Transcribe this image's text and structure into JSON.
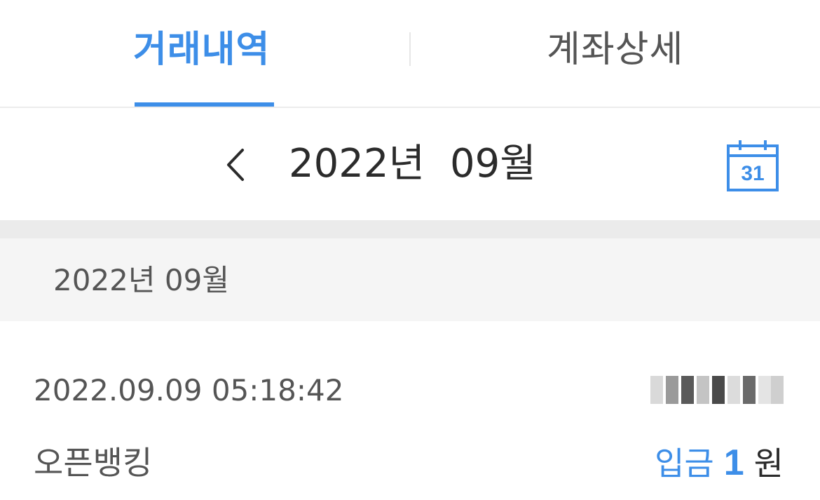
{
  "tabs": [
    {
      "label": "거래내역",
      "active": true
    },
    {
      "label": "계좌상세",
      "active": false
    }
  ],
  "month_selector": {
    "year": "2022년",
    "month": "09월",
    "calendar_day": "31"
  },
  "section": {
    "title": "2022년 09월"
  },
  "transactions": [
    {
      "datetime": "2022.09.09  05:18:42",
      "description": "오픈뱅킹",
      "type": "입금",
      "amount": "1",
      "unit": "원"
    }
  ],
  "colors": {
    "accent": "#3d8ee8",
    "text": "#555555",
    "band": "#ebebeb",
    "section_bg": "#f5f5f5"
  }
}
